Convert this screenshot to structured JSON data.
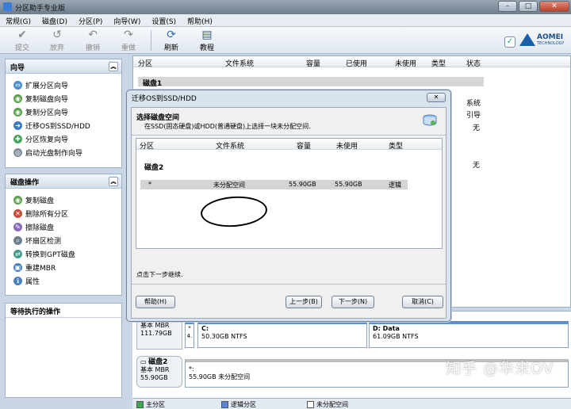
{
  "window": {
    "title": "分区助手专业版"
  },
  "menu": [
    "常规(G)",
    "磁盘(D)",
    "分区(P)",
    "向导(W)",
    "设置(S)",
    "帮助(H)"
  ],
  "toolbar": {
    "buttons": [
      {
        "label": "提交",
        "icon": "check-icon",
        "enabled": false
      },
      {
        "label": "放弃",
        "icon": "discard-icon",
        "enabled": false
      },
      {
        "label": "撤销",
        "icon": "undo-icon",
        "enabled": false
      },
      {
        "label": "重做",
        "icon": "redo-icon",
        "enabled": false
      },
      {
        "label": "刷新",
        "icon": "refresh-icon",
        "enabled": true
      },
      {
        "label": "教程",
        "icon": "tutorial-icon",
        "enabled": true
      }
    ],
    "logo_line1": "AOMEI",
    "logo_line2": "TECHNOLOGY"
  },
  "sidebar": {
    "wizard": {
      "title": "向导",
      "items": [
        "扩展分区向导",
        "复制磁盘向导",
        "复制分区向导",
        "迁移OS到SSD/HDD",
        "分区恢复向导",
        "启动光盘制作向导"
      ]
    },
    "disk_ops": {
      "title": "磁盘操作",
      "items": [
        "复制磁盘",
        "删除所有分区",
        "擦除磁盘",
        "坏扇区检测",
        "转换到GPT磁盘",
        "重建MBR",
        "属性"
      ]
    },
    "pending": {
      "title": "等待执行的操作"
    }
  },
  "partition_list": {
    "columns": [
      "分区",
      "文件系统",
      "容量",
      "已使用",
      "未使用",
      "类型",
      "状态"
    ],
    "disk1_label": "磁盘1",
    "status_values": [
      "系统",
      "引导",
      "无",
      "无"
    ]
  },
  "disk_map": {
    "disk1": {
      "name": "",
      "type": "基本 MBR",
      "size": "111.79GB"
    },
    "disk1_parts": [
      {
        "num": "*",
        "name": "",
        "detail": ""
      },
      {
        "num": "4.",
        "name": "C:",
        "detail": "50.30GB NTFS"
      },
      {
        "num": "",
        "name": "D: Data",
        "detail": "61.09GB NTFS"
      }
    ],
    "disk2": {
      "name": "磁盘2",
      "type": "基本 MBR",
      "size": "55.90GB"
    },
    "disk2_part": {
      "name": "*:",
      "detail": "55.90GB 未分配空间"
    }
  },
  "legend": [
    "主分区",
    "逻辑分区",
    "未分配空间"
  ],
  "watermark": "知乎 @华米OV",
  "dialog": {
    "title": "迁移OS到SSD/HDD",
    "close": "✕",
    "heading": "选择磁盘空间",
    "subtitle": "在SSD(固态硬盘)或HDD(普通硬盘)上选择一块未分配空间.",
    "columns": [
      "分区",
      "文件系统",
      "容量",
      "未使用",
      "类型"
    ],
    "disk": "磁盘2",
    "row": {
      "partition": "*",
      "fs": "未分配空间",
      "capacity": "55.90GB",
      "free": "55.90GB",
      "type": "逻辑"
    },
    "hint": "点击下一步继续.",
    "buttons": {
      "help": "帮助(H)",
      "back": "上一步(B)",
      "next": "下一步(N)",
      "cancel": "取消(C)"
    }
  }
}
